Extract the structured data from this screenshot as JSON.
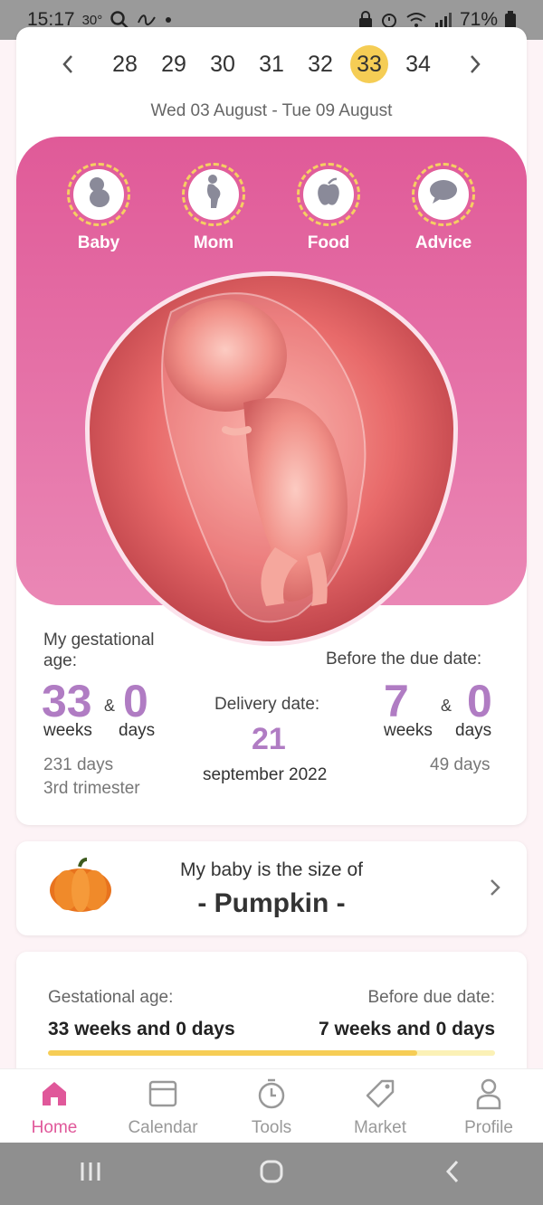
{
  "status_bar": {
    "time": "15:17",
    "temp": "30°",
    "battery": "71%",
    "icons": [
      "search-icon",
      "wave-icon",
      "dot-icon",
      "lock-icon",
      "alarm-icon",
      "wifi-icon",
      "signal-icon",
      "battery-icon"
    ]
  },
  "week_nav": {
    "weeks": [
      "28",
      "29",
      "30",
      "31",
      "32",
      "33",
      "34"
    ],
    "active_week": "33",
    "date_range": "Wed 03 August - Tue 09 August"
  },
  "categories": [
    {
      "label": "Baby",
      "icon": "baby-icon"
    },
    {
      "label": "Mom",
      "icon": "pregnant-mom-icon"
    },
    {
      "label": "Food",
      "icon": "apple-icon"
    },
    {
      "label": "Advice",
      "icon": "speech-bubble-icon"
    }
  ],
  "stats": {
    "gestational_label": "My gestational age:",
    "gest_weeks": "33",
    "gest_days": "0",
    "amp": "&",
    "weeks_unit": "weeks",
    "days_unit": "days",
    "total_days": "231 days",
    "trimester": "3rd trimester",
    "delivery_label": "Delivery date:",
    "delivery_day": "21",
    "delivery_month": "september 2022",
    "before_label": "Before the due date:",
    "before_weeks": "7",
    "before_days": "0",
    "before_total_days": "49 days"
  },
  "size_card": {
    "title": "My baby is the size of",
    "value": "- Pumpkin -"
  },
  "progress_card": {
    "left_label": "Gestational age:",
    "left_value": "33 weeks and 0 days",
    "right_label": "Before due date:",
    "right_value": "7 weeks and 0 days",
    "progress_fraction": 0.825
  },
  "tabs": [
    {
      "label": "Home",
      "icon": "home-icon",
      "active": true
    },
    {
      "label": "Calendar",
      "icon": "calendar-icon",
      "active": false
    },
    {
      "label": "Tools",
      "icon": "stopwatch-icon",
      "active": false
    },
    {
      "label": "Market",
      "icon": "tag-icon",
      "active": false
    },
    {
      "label": "Profile",
      "icon": "person-icon",
      "active": false
    }
  ],
  "colors": {
    "accent_pink": "#e0589a",
    "accent_yellow": "#f6cd55",
    "number_purple": "#b07cc3"
  }
}
